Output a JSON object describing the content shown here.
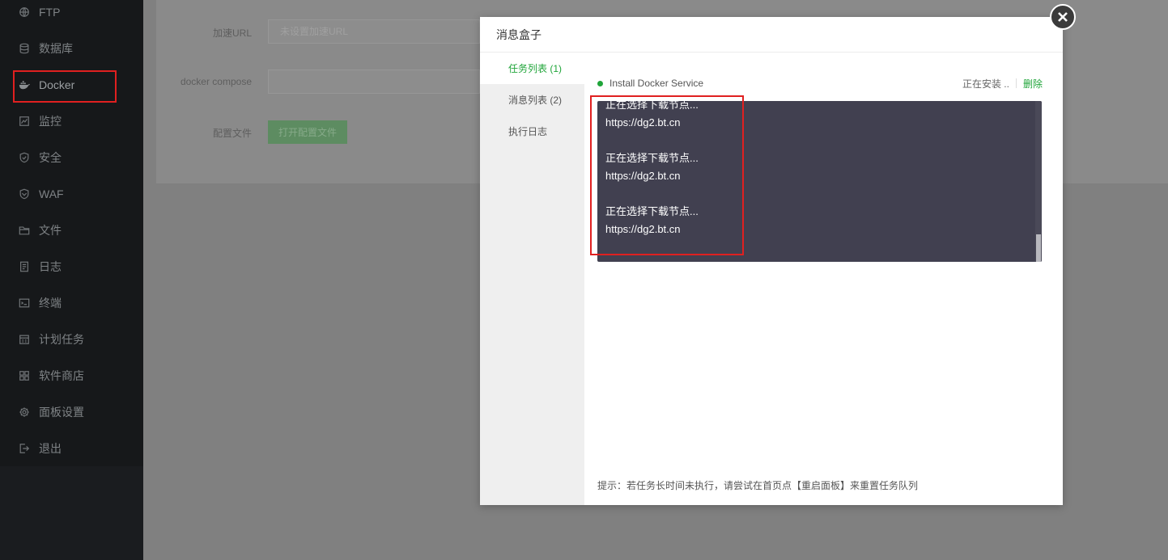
{
  "sidebar": {
    "items": [
      {
        "label": "FTP",
        "icon": "globe-icon"
      },
      {
        "label": "数据库",
        "icon": "database-icon"
      },
      {
        "label": "Docker",
        "icon": "docker-icon"
      },
      {
        "label": "监控",
        "icon": "monitor-icon"
      },
      {
        "label": "安全",
        "icon": "shield-icon"
      },
      {
        "label": "WAF",
        "icon": "waf-shield-icon"
      },
      {
        "label": "文件",
        "icon": "folder-icon"
      },
      {
        "label": "日志",
        "icon": "log-icon"
      },
      {
        "label": "终端",
        "icon": "terminal-icon"
      },
      {
        "label": "计划任务",
        "icon": "calendar-icon"
      },
      {
        "label": "软件商店",
        "icon": "grid-icon"
      },
      {
        "label": "面板设置",
        "icon": "gear-icon"
      },
      {
        "label": "退出",
        "icon": "logout-icon"
      }
    ],
    "active": "Docker"
  },
  "background": {
    "mirror_label": "加速URL",
    "mirror_placeholder": "未设置加速URL",
    "compose_label": "docker compose",
    "compose_value": "",
    "config_label": "配置文件",
    "config_button": "打开配置文件"
  },
  "dialog": {
    "title": "消息盒子",
    "tabs": [
      {
        "label": "任务列表 (1)",
        "active": true
      },
      {
        "label": "消息列表 (2)",
        "active": false
      },
      {
        "label": "执行日志",
        "active": false
      }
    ],
    "task": {
      "name": "Install Docker Service",
      "status": "正在安装 ..",
      "delete_label": "删除"
    },
    "log_lines": [
      "正在选择下载节点...",
      "https://dg2.bt.cn",
      "",
      "正在选择下载节点...",
      "https://dg2.bt.cn",
      "",
      "正在选择下载节点...",
      "https://dg2.bt.cn"
    ],
    "tip": "提示：若任务长时间未执行，请尝试在首页点【重启面板】来重置任务队列"
  },
  "colors": {
    "accent": "#20a53a",
    "highlight": "#e02020",
    "log_bg": "#414050"
  }
}
